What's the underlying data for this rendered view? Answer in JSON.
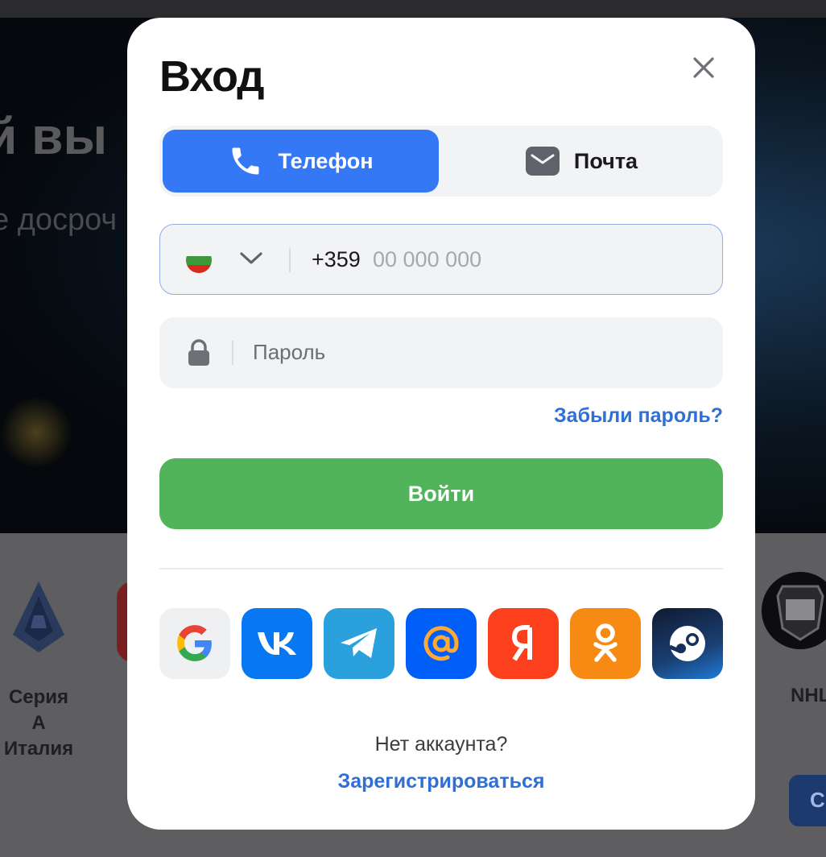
{
  "background": {
    "hero_title": "й вы",
    "hero_subtitle": "е досроч",
    "league_left_label": "Серия А Италия",
    "league_right_label": "NHL",
    "right_button_label": "С"
  },
  "modal": {
    "title": "Вход",
    "close_icon": "close-icon",
    "tabs": [
      {
        "label": "Телефон",
        "icon": "phone-icon",
        "active": true
      },
      {
        "label": "Почта",
        "icon": "mail-icon",
        "active": false
      }
    ],
    "phone": {
      "country_flag": "flag-bulgaria",
      "country_code": "+359",
      "placeholder": "00 000 000",
      "value": ""
    },
    "password": {
      "placeholder": "Пароль",
      "value": ""
    },
    "forgot_label": "Забыли пароль?",
    "login_label": "Войти",
    "social": [
      "google",
      "vk",
      "telegram",
      "mail-ru",
      "yandex",
      "odnoklassniki",
      "steam"
    ],
    "no_account_label": "Нет аккаунта?",
    "register_label": "Зарегистрироваться"
  },
  "colors": {
    "accent_blue": "#3478f6",
    "link_blue": "#2f6fd6",
    "login_green": "#52b45a"
  }
}
